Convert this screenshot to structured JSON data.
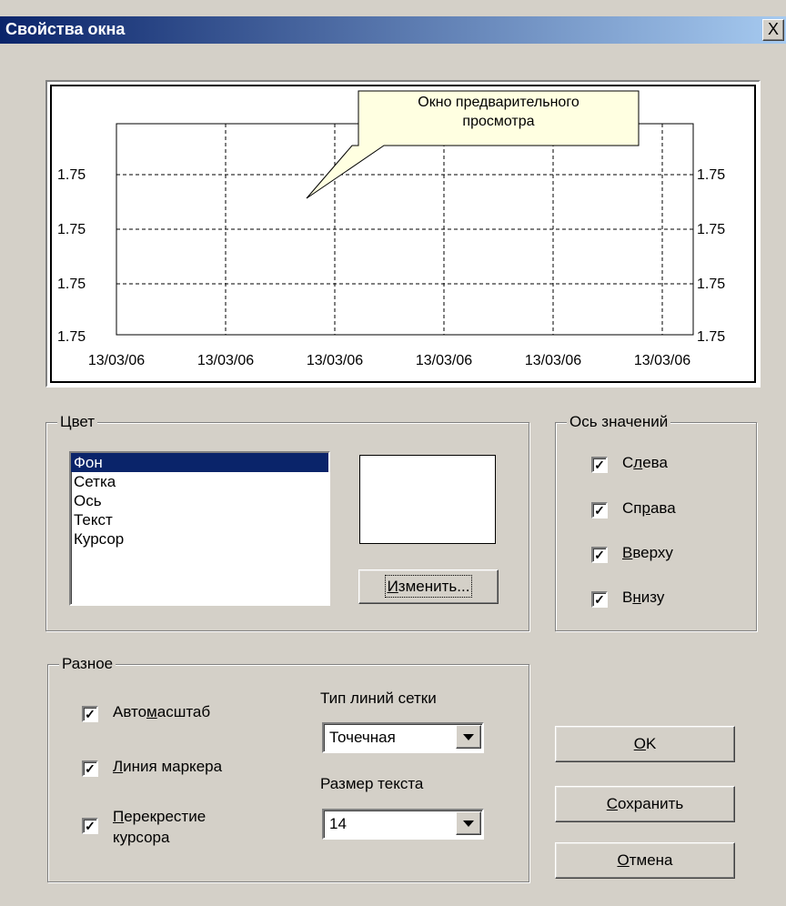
{
  "window": {
    "title": "Свойства окна",
    "close_label": "X"
  },
  "preview": {
    "tooltip_line1": "Окно предварительного",
    "tooltip_line2": "просмотра",
    "y_labels_left": [
      "1.75",
      "1.75",
      "1.75",
      "1.75"
    ],
    "y_labels_right": [
      "1.75",
      "1.75",
      "1.75",
      "1.75"
    ],
    "x_labels": [
      "13/03/06",
      "13/03/06",
      "13/03/06",
      "13/03/06",
      "13/03/06",
      "13/03/06"
    ]
  },
  "color_group": {
    "label": "Цвет",
    "items": [
      "Фон",
      "Сетка",
      "Ось",
      "Текст",
      "Курсор"
    ],
    "selected_index": 0,
    "swatch_color": "#ffffff",
    "change_button": "Изменить...",
    "change_button_hotkey": "И",
    "change_button_rest": "зменить..."
  },
  "axis_group": {
    "label": "Ось значений",
    "options": [
      {
        "pre": "С",
        "hot": "л",
        "post": "ева",
        "checked": true
      },
      {
        "pre": "Сп",
        "hot": "р",
        "post": "ава",
        "checked": true
      },
      {
        "pre": "",
        "hot": "В",
        "post": "верху",
        "checked": true
      },
      {
        "pre": "В",
        "hot": "н",
        "post": "изу",
        "checked": true
      }
    ]
  },
  "misc_group": {
    "label": "Разное",
    "autoscale": {
      "pre": "Авто",
      "hot": "м",
      "post": "асштаб",
      "checked": true
    },
    "marker_line": {
      "pre": "",
      "hot": "Л",
      "post": "иния маркера",
      "checked": true
    },
    "crosshair": {
      "line1_hot": "П",
      "line1_rest": "ерекрестие",
      "line2": "курсора",
      "checked": true
    },
    "grid_type_label": "Тип линий сетки",
    "grid_type_value": "Точечная",
    "text_size_label": "Размер текста",
    "text_size_value": "14"
  },
  "buttons": {
    "ok_hot": "O",
    "ok_rest": "K",
    "save_hot": "С",
    "save_rest": "охранить",
    "cancel_hot": "О",
    "cancel_rest": "тмена"
  },
  "colors": {
    "title_start": "#0a246a",
    "title_end": "#a6caf0",
    "dialog_bg": "#d4d0c8",
    "selection": "#0a246a",
    "tooltip_bg": "#ffffe1"
  }
}
